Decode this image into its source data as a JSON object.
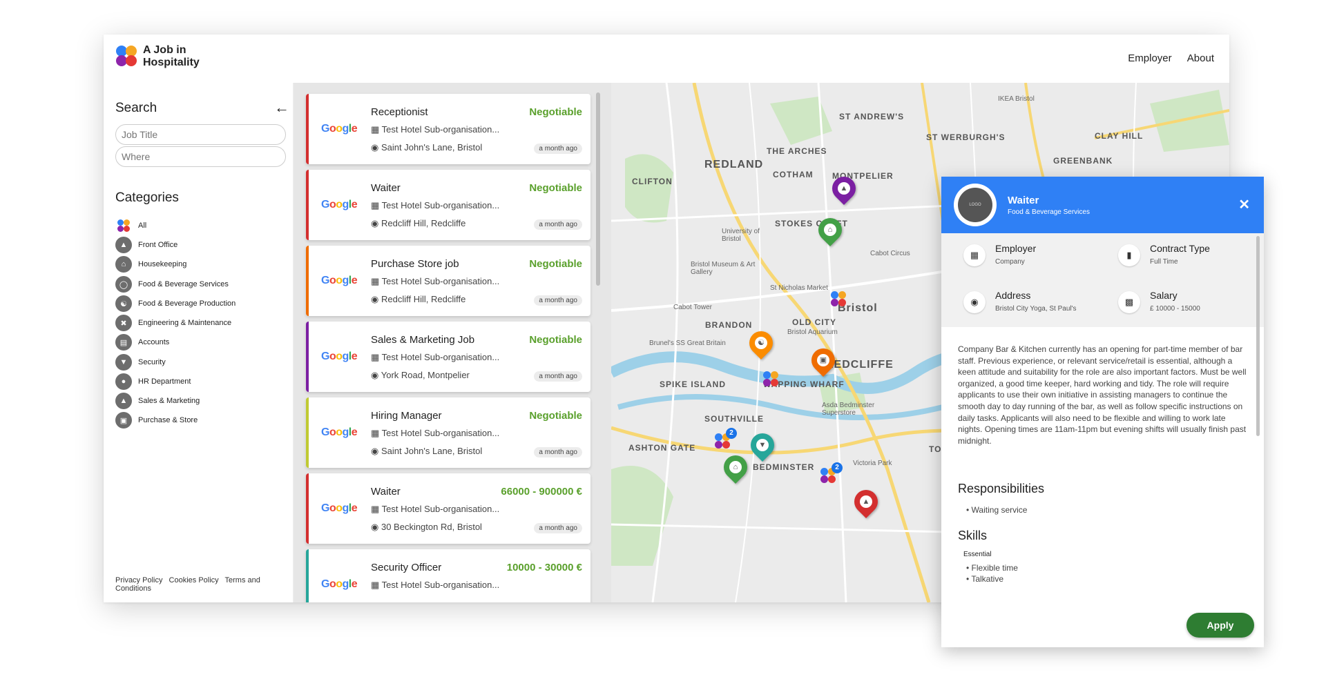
{
  "app": {
    "name": "A Job in Hospitality",
    "nav": [
      "Employer",
      "About"
    ]
  },
  "search": {
    "title": "Search",
    "job_title_placeholder": "Job Title",
    "where_placeholder": "Where"
  },
  "categories": {
    "title": "Categories",
    "items": [
      "All",
      "Front Office",
      "Housekeeping",
      "Food & Beverage Services",
      "Food & Beverage Production",
      "Engineering & Maintenance",
      "Accounts",
      "Security",
      "HR Department",
      "Sales & Marketing",
      "Purchase & Store"
    ]
  },
  "footer": [
    "Privacy Policy",
    "Cookies Policy",
    "Terms and Conditions"
  ],
  "jobs": [
    {
      "title": "Receptionist",
      "salary": "Negotiable",
      "org": "Test Hotel Sub-organisation...",
      "location": "Saint John's Lane, Bristol",
      "age": "a month ago",
      "color": "#d32f2f"
    },
    {
      "title": "Waiter",
      "salary": "Negotiable",
      "org": "Test Hotel Sub-organisation...",
      "location": "Redcliff Hill, Redcliffe",
      "age": "a month ago",
      "color": "#d32f2f"
    },
    {
      "title": "Purchase Store job",
      "salary": "Negotiable",
      "org": "Test Hotel Sub-organisation...",
      "location": "Redcliff Hill, Redcliffe",
      "age": "a month ago",
      "color": "#ef6c00"
    },
    {
      "title": "Sales & Marketing Job",
      "salary": "Negotiable",
      "org": "Test Hotel Sub-organisation...",
      "location": "York Road, Montpelier",
      "age": "a month ago",
      "color": "#7b1fa2"
    },
    {
      "title": "Hiring Manager",
      "salary": "Negotiable",
      "org": "Test Hotel Sub-organisation...",
      "location": "Saint John's Lane, Bristol",
      "age": "a month ago",
      "color": "#c0ca33"
    },
    {
      "title": "Waiter",
      "salary": "66000 - 900000 €",
      "org": "Test Hotel Sub-organisation...",
      "location": "30 Beckington Rd, Bristol",
      "age": "a month ago",
      "color": "#d32f2f"
    },
    {
      "title": "Security Officer",
      "salary": "10000 - 30000 €",
      "org": "Test Hotel Sub-organisation...",
      "location": "",
      "age": "",
      "color": "#26a69a"
    }
  ],
  "google_label": "Google",
  "map": {
    "labels": [
      "REDLAND",
      "CLIFTON",
      "COTHAM",
      "THE ARCHES",
      "MONTPELIER",
      "ST ANDREW'S",
      "ST WERBURGH'S",
      "CLAY HILL",
      "GREENBANK",
      "STOKES CROFT",
      "Bristol",
      "OLD CITY",
      "BRANDON",
      "SPIKE ISLAND",
      "WAPPING WHARF",
      "REDCLIFFE",
      "SOUTHVILLE",
      "ASHTON GATE",
      "BEDMINSTER",
      "TOTTERDOWN",
      "IKEA Bristol",
      "University of Bristol",
      "Bristol Museum & Art Gallery",
      "St Nicholas Market",
      "Cabot Tower",
      "Cabot Circus",
      "Bristol Aquarium",
      "Brunel's SS Great Britain",
      "Asda Bedminster Superstore",
      "Victoria Park"
    ],
    "clusters": [
      {
        "count": "2"
      },
      {
        "count": "2"
      }
    ]
  },
  "detail": {
    "logo_text": "LOGO",
    "title": "Waiter",
    "subtitle": "Food & Beverage Services",
    "close": "✕",
    "employer_label": "Employer",
    "employer_value": "Company",
    "contract_label": "Contract Type",
    "contract_value": "Full Time",
    "address_label": "Address",
    "address_value": "Bristol City Yoga, St Paul's",
    "salary_label": "Salary",
    "salary_value": "£ 10000 - 15000",
    "description": "Company Bar & Kitchen currently has an opening for part-time member of bar staff. Previous experience, or relevant service/retail is essential, although a keen attitude and suitability for the role are also important factors. Must be well organized, a good time keeper, hard working and tidy. The role will require applicants to use their own initiative in assisting managers to continue the smooth day to day running of the bar, as well as follow specific instructions on daily tasks. Applicants will also need to be flexible and willing to work late nights. Opening times are 11am-11pm but evening shifts will usually finish past midnight.",
    "responsibilities_title": "Responsibilities",
    "responsibilities": [
      "Waiting service"
    ],
    "skills_title": "Skills",
    "skills_group": "Essential",
    "skills": [
      "Flexible time",
      "Talkative"
    ],
    "apply": "Apply"
  },
  "colors": {
    "accent": "#2f80f5",
    "negotiable": "#5aa02c",
    "apply": "#2e7d32"
  }
}
